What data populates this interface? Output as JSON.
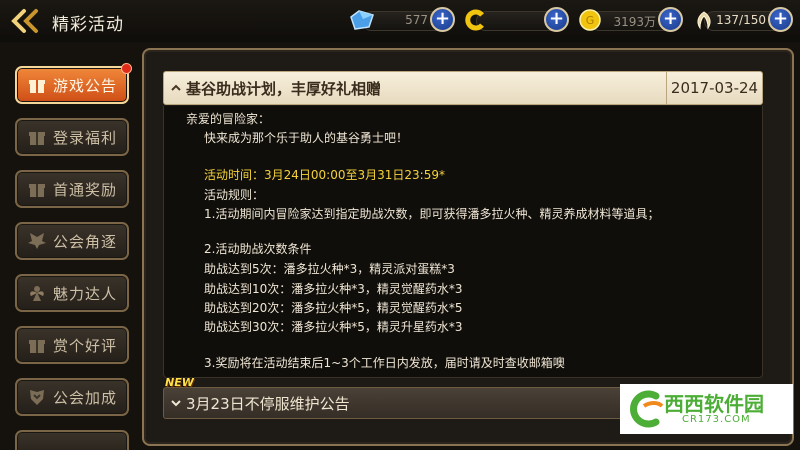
{
  "header": {
    "title": "精彩活动",
    "resources": [
      {
        "icon": "blue-crystal-icon",
        "value": "577",
        "color": "#4a9fe8"
      },
      {
        "icon": "gold-c-icon",
        "value": "",
        "color": "#f1c40f"
      },
      {
        "icon": "gold-coin-icon",
        "value": "3193万",
        "color": "#f1c40f"
      },
      {
        "icon": "energy-wings-icon",
        "value": "137/150",
        "color": "#e6d6a8"
      }
    ]
  },
  "sidebar": {
    "items": [
      {
        "label": "游戏公告",
        "icon": "gift-icon",
        "active": true,
        "badge": true
      },
      {
        "label": "登录福利",
        "icon": "gift-icon"
      },
      {
        "label": "首通奖励",
        "icon": "gift-icon"
      },
      {
        "label": "公会角逐",
        "icon": "wings-emblem-icon"
      },
      {
        "label": "魅力达人",
        "icon": "fairy-icon"
      },
      {
        "label": "赏个好评",
        "icon": "gift-icon"
      },
      {
        "label": "公会加成",
        "icon": "shield-crest-icon"
      }
    ]
  },
  "announcement": {
    "title": "基谷助战计划，丰厚好礼相赠",
    "date": "2017-03-24",
    "body": [
      {
        "text": "亲爱的冒险家：",
        "highlight": false
      },
      {
        "text": "快来成为那个乐于助人的基谷勇士吧！",
        "highlight": false
      },
      {
        "text": "",
        "highlight": false
      },
      {
        "text": "活动时间：3月24日00:00至3月31日23:59*",
        "highlight": true
      },
      {
        "text": "活动规则：",
        "highlight": false
      },
      {
        "text": "1.活动期间内冒险家达到指定助战次数，即可获得潘多拉火种、精灵养成材料等道具；",
        "highlight": false
      },
      {
        "text": "",
        "highlight": false
      },
      {
        "text": "2.活动助战次数条件",
        "highlight": false
      },
      {
        "text": "助战达到5次：潘多拉火种*3，精灵派对蛋糕*3",
        "highlight": false
      },
      {
        "text": "助战达到10次：潘多拉火种*3，精灵觉醒药水*3",
        "highlight": false
      },
      {
        "text": "助战达到20次：潘多拉火种*5，精灵觉醒药水*5",
        "highlight": false
      },
      {
        "text": "助战达到30次：潘多拉火种*5，精灵升星药水*3",
        "highlight": false
      },
      {
        "text": "",
        "highlight": false
      },
      {
        "text": "3.奖励将在活动结束后1~3个工作日内发放，届时请及时查收邮箱噢",
        "highlight": false
      }
    ]
  },
  "announcement2": {
    "badge": "NEW",
    "title": "3月23日不停服维护公告"
  },
  "watermark": {
    "brand": "西西软件园",
    "url": "CR173.COM"
  }
}
